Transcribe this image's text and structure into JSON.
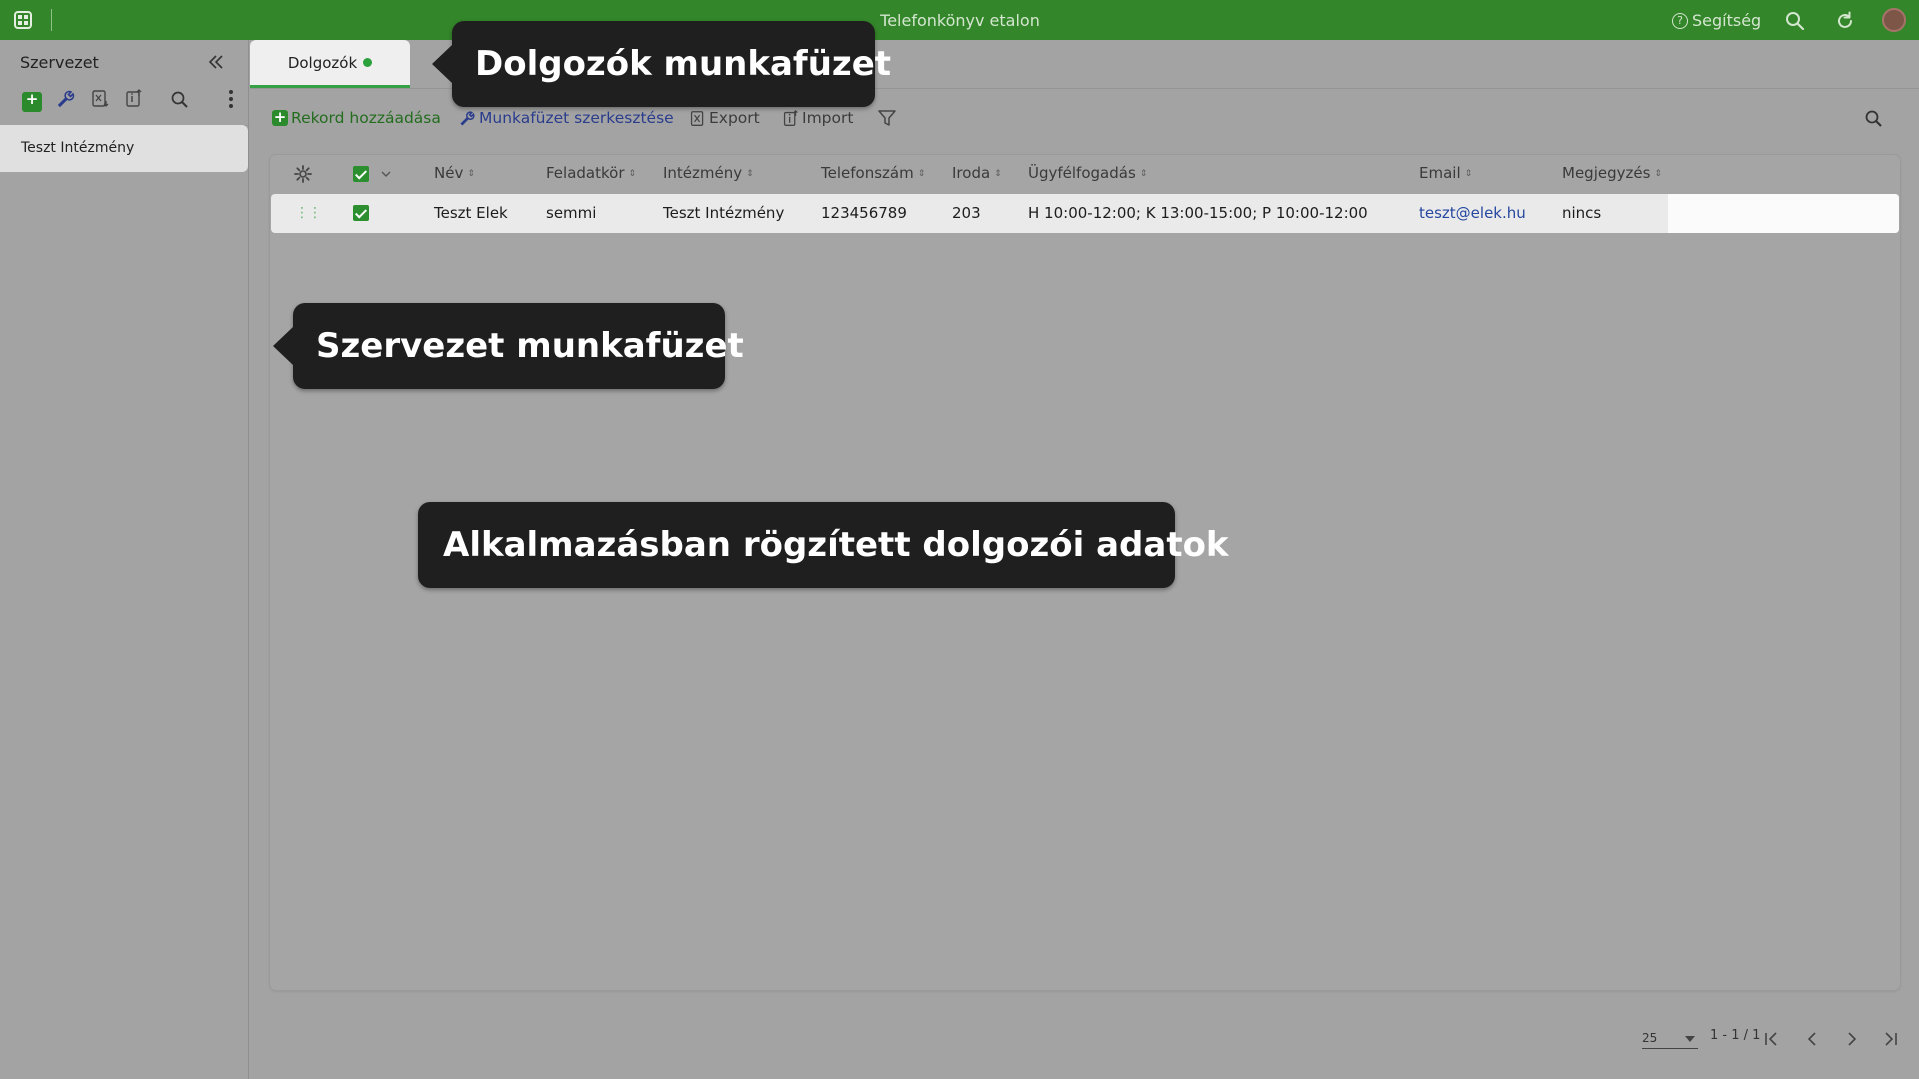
{
  "app": {
    "title": "Telefonkönyv etalon",
    "help_label": "Segítség"
  },
  "sidebar": {
    "title": "Szervezet",
    "items": [
      {
        "label": "Teszt Intézmény"
      }
    ]
  },
  "tabs": [
    {
      "label": "Dolgozók",
      "status_color": "#2aa13b"
    }
  ],
  "toolbar": {
    "add_record": "Rekord hozzáadása",
    "edit_workbook": "Munkafüzet szerkesztése",
    "export": "Export",
    "import": "Import"
  },
  "table": {
    "columns": [
      "Név",
      "Feladatkör",
      "Intézmény",
      "Telefonszám",
      "Iroda",
      "Ügyfélfogadás",
      "Email",
      "Megjegyzés"
    ],
    "rows": [
      {
        "name": "Teszt Elek",
        "role": "semmi",
        "institution": "Teszt Intézmény",
        "phone": "123456789",
        "office": "203",
        "hours": "H 10:00-12:00; K 13:00-15:00; P 10:00-12:00",
        "email": "teszt@elek.hu",
        "note": "nincs",
        "checked": true
      }
    ]
  },
  "pagination": {
    "page_size": "25",
    "range": "1 - 1 / 1"
  },
  "annotations": {
    "tab_callout": "Dolgozók munkafüzet",
    "sidebar_callout": "Szervezet munkafüzet",
    "data_callout": "Alkalmazásban rögzített dolgozói adatok"
  },
  "colors": {
    "brand_green": "#34862a",
    "accent_green": "#2a8a2c",
    "link_blue": "#2547a0",
    "tooltip_bg": "#1f1f1f"
  }
}
